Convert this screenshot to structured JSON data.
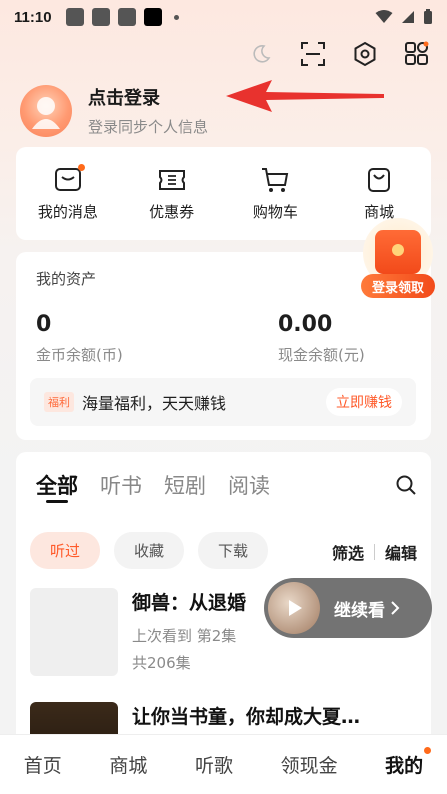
{
  "status_bar": {
    "time": "11:10"
  },
  "profile": {
    "title": "点击登录",
    "subtitle": "登录同步个人信息"
  },
  "quick_actions": [
    {
      "label": "我的消息",
      "icon": "message-icon",
      "has_dot": true
    },
    {
      "label": "优惠券",
      "icon": "coupon-icon",
      "has_dot": false
    },
    {
      "label": "购物车",
      "icon": "cart-icon",
      "has_dot": false
    },
    {
      "label": "商城",
      "icon": "shop-bag-icon",
      "has_dot": false
    }
  ],
  "assets": {
    "title": "我的资产",
    "coin_value": "0",
    "coin_label": "金币余额(币)",
    "cash_value": "0.00",
    "cash_label": "现金余额(元)",
    "welfare_tag": "福利",
    "welfare_text": "海量福利，天天赚钱",
    "welfare_button": "立即赚钱"
  },
  "promo": {
    "button": "登录领取"
  },
  "history": {
    "tabs": [
      "全部",
      "听书",
      "短剧",
      "阅读"
    ],
    "filters": [
      "听过",
      "收藏",
      "下载"
    ],
    "filter_right": [
      "筛选",
      "编辑"
    ],
    "books": [
      {
        "title": "御兽：从退婚",
        "progress": "上次看到 第2集",
        "count": "共206集"
      },
      {
        "title": "让你当书童，你却成大夏…"
      }
    ]
  },
  "continue_watch": {
    "label": "继续看"
  },
  "bottom_nav": [
    "首页",
    "商城",
    "听歌",
    "领现金",
    "我的"
  ],
  "colors": {
    "accent": "#ff5a2a",
    "dot": "#ff6a1a"
  }
}
